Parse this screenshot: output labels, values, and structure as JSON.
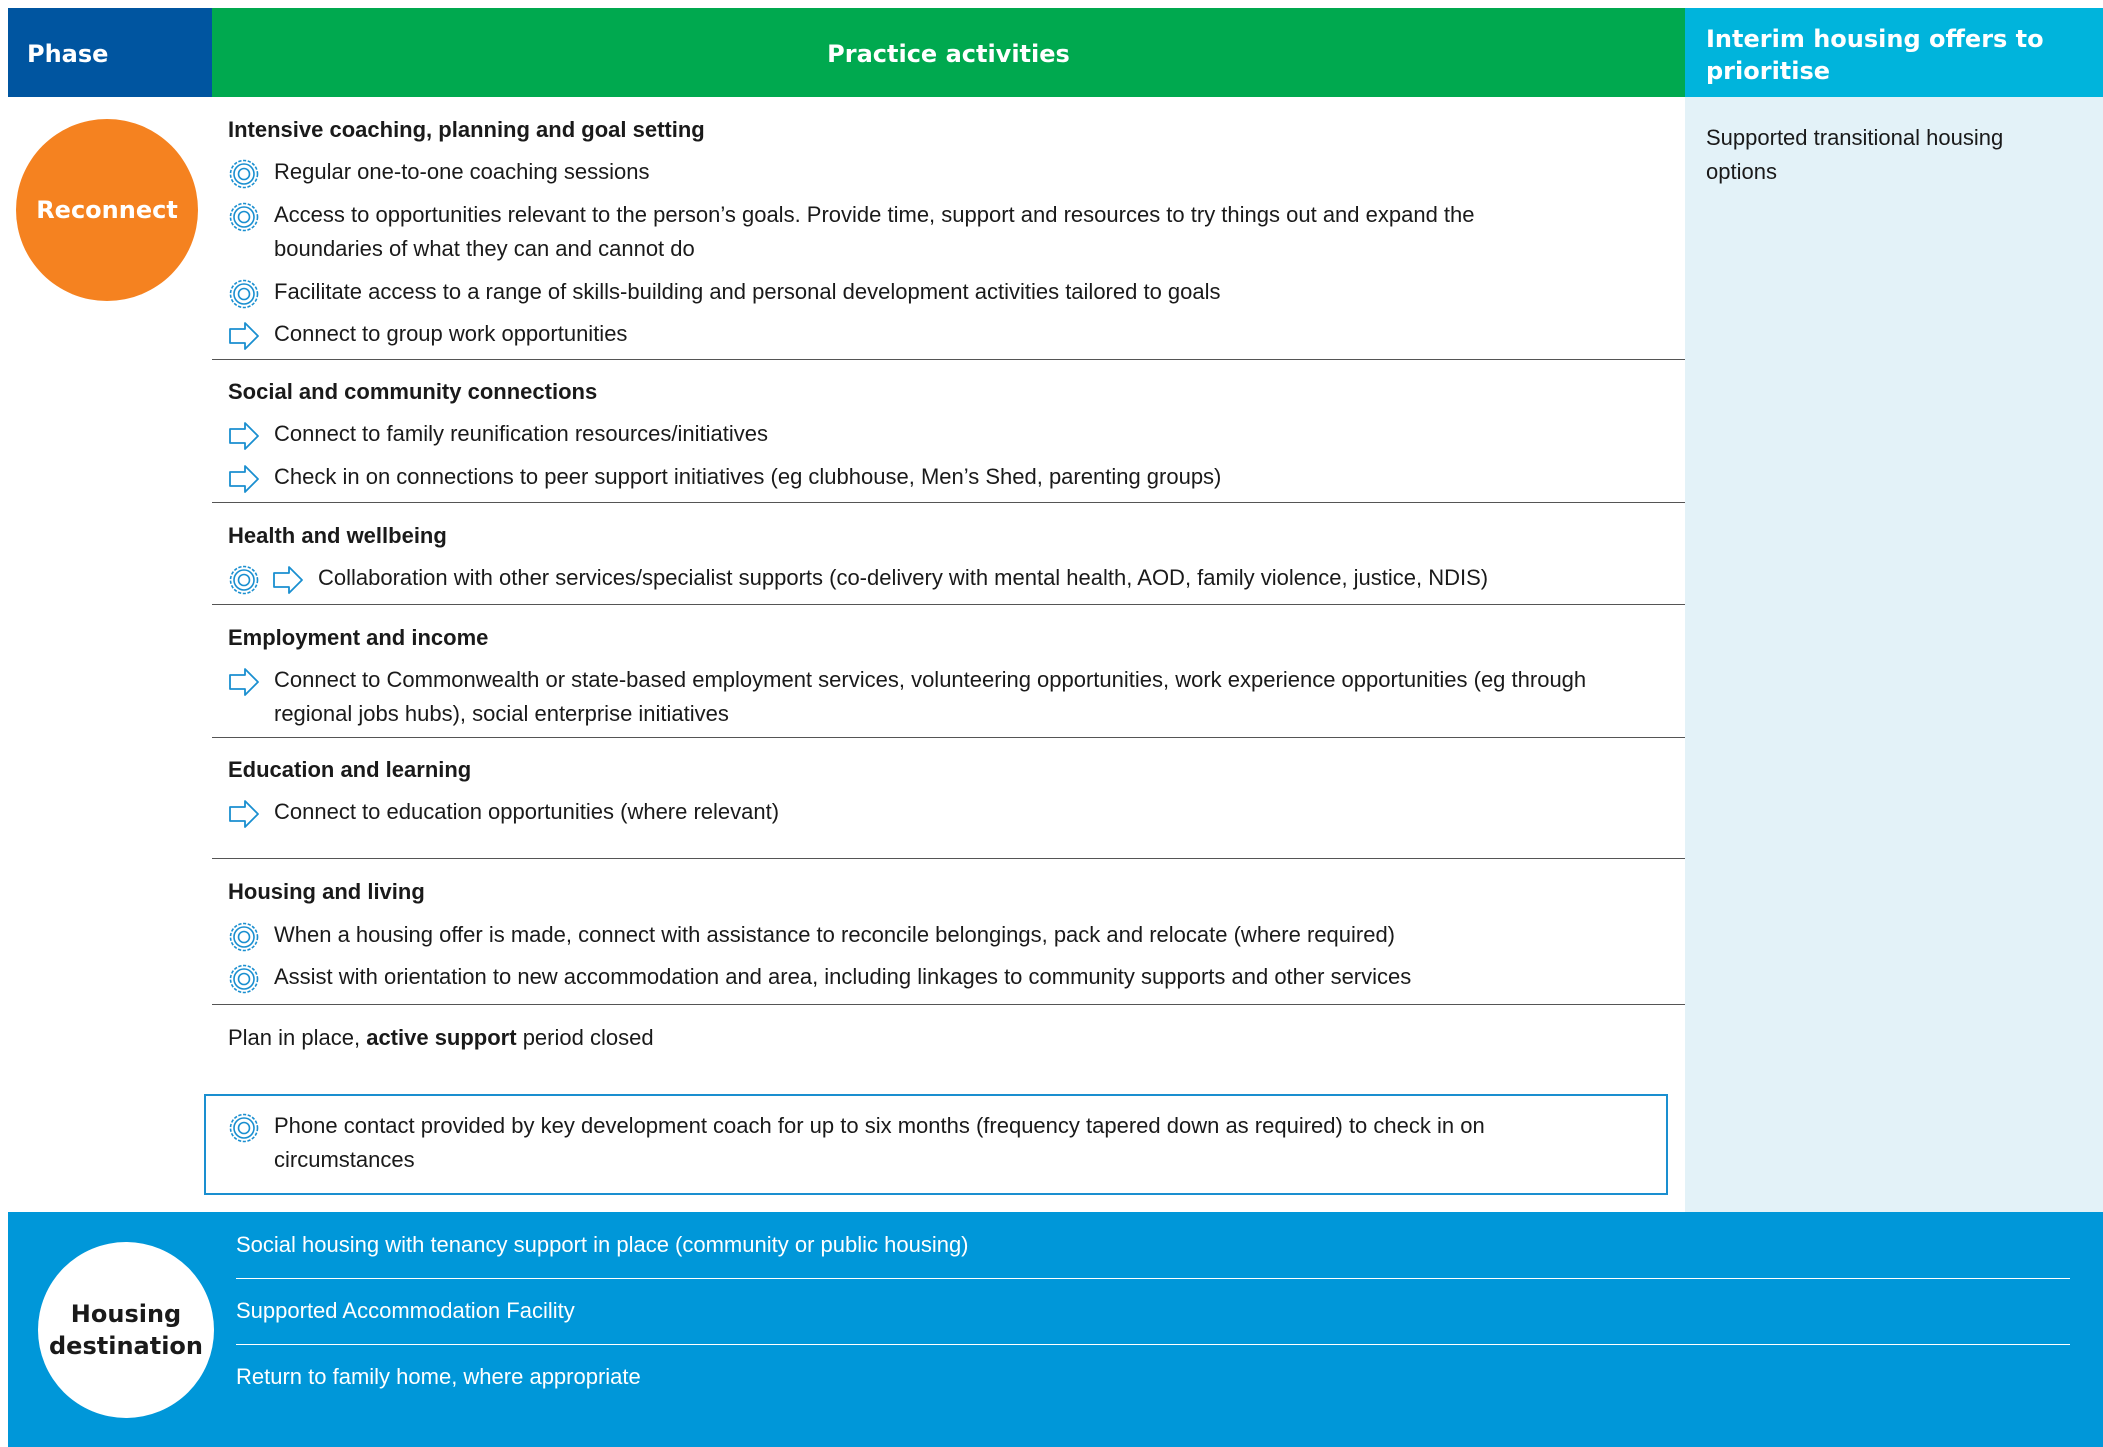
{
  "header": {
    "phase": "Phase",
    "practice": "Practice activities",
    "interim": "Interim housing offers to prioritise"
  },
  "phase_label": "Reconnect",
  "interim_text": "Supported transitional housing options",
  "sections": [
    {
      "title": "Intensive coaching, planning and goal setting",
      "items": [
        {
          "icons": [
            "target-icon"
          ],
          "text": "Regular one-to-one coaching sessions"
        },
        {
          "icons": [
            "target-icon"
          ],
          "text": "Access to opportunities relevant to the person’s goals. Provide time, support and resources to try things out and expand the boundaries of what they can and cannot do"
        },
        {
          "icons": [
            "target-icon"
          ],
          "text": "Facilitate access to a range of skills-building and personal development activities tailored to goals"
        },
        {
          "icons": [
            "arrow-icon"
          ],
          "text": "Connect to group work opportunities"
        }
      ]
    },
    {
      "title": "Social and community connections",
      "items": [
        {
          "icons": [
            "arrow-icon"
          ],
          "text": "Connect to family reunification resources/initiatives"
        },
        {
          "icons": [
            "arrow-icon"
          ],
          "text": "Check in on connections to peer support initiatives (eg clubhouse, Men’s Shed, parenting groups)"
        }
      ]
    },
    {
      "title": "Health and wellbeing",
      "items": [
        {
          "icons": [
            "target-icon",
            "arrow-icon"
          ],
          "text": "Collaboration with other services/specialist supports (co-delivery with mental health, AOD, family violence, justice, NDIS)"
        }
      ]
    },
    {
      "title": "Employment and income",
      "items": [
        {
          "icons": [
            "arrow-icon"
          ],
          "text": "Connect to Commonwealth or state-based employment services, volunteering opportunities, work experience opportunities (eg through regional jobs hubs), social enterprise initiatives"
        }
      ]
    },
    {
      "title": "Education and learning",
      "items": [
        {
          "icons": [
            "arrow-icon"
          ],
          "text": "Connect to education opportunities (where relevant)"
        }
      ]
    },
    {
      "title": "Housing and living",
      "items": [
        {
          "icons": [
            "target-icon"
          ],
          "text": "When a housing offer is made, connect with assistance to reconcile belongings, pack and relocate (where required)"
        },
        {
          "icons": [
            "target-icon"
          ],
          "text": "Assist with orientation to new accommodation and area, including linkages to community supports and other services"
        }
      ]
    }
  ],
  "plan": {
    "prefix": "Plan in place, ",
    "bold": "active support",
    "suffix": " period closed"
  },
  "phone_contact": {
    "icons": [
      "target-icon"
    ],
    "text": "Phone contact provided by key development coach for up to six months (frequency tapered down as required) to check in on circumstances"
  },
  "destination": {
    "label": "Housing destination",
    "items": [
      "Social housing with tenancy support in place (community or public housing)",
      "Supported Accommodation Facility",
      "Return to family home, where appropriate"
    ]
  },
  "colors": {
    "phase_header": "#0055a0",
    "practice_header": "#00a94f",
    "interim_header": "#00b4dc",
    "interim_column": "#e3f2f8",
    "reconnect": "#f58220",
    "destination": "#0097d9",
    "icon": "#1a8fd0"
  }
}
